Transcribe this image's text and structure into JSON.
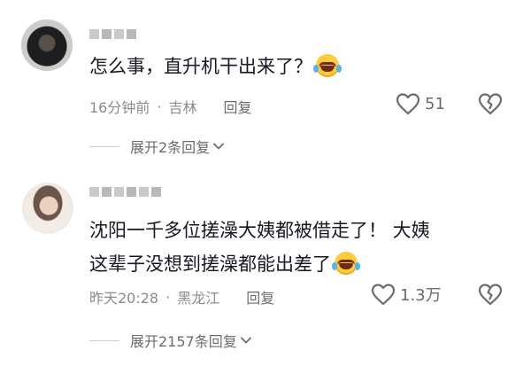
{
  "comments": [
    {
      "text": "怎么事，直升机干出来了？",
      "time": "16分钟前",
      "location": "吉林",
      "reply_label": "回复",
      "likes": "51",
      "expand_label": "展开2条回复"
    },
    {
      "text_line1": "沈阳一千多位搓澡大姨都被借走了！ 大姨",
      "text_line2": "这辈子没想到搓澡都能出差了",
      "time": "昨天20:28",
      "location": "黑龙江",
      "reply_label": "回复",
      "likes": "1.3万",
      "expand_label": "展开2157条回复"
    }
  ],
  "icons": {
    "emoji": "laughing-tears-emoji",
    "like": "heart-outline-icon",
    "dislike": "broken-heart-icon",
    "expand": "chevron-down-icon"
  },
  "colors": {
    "text": "#161823",
    "meta": "#8a8b91",
    "icon": "#6b6c72"
  }
}
